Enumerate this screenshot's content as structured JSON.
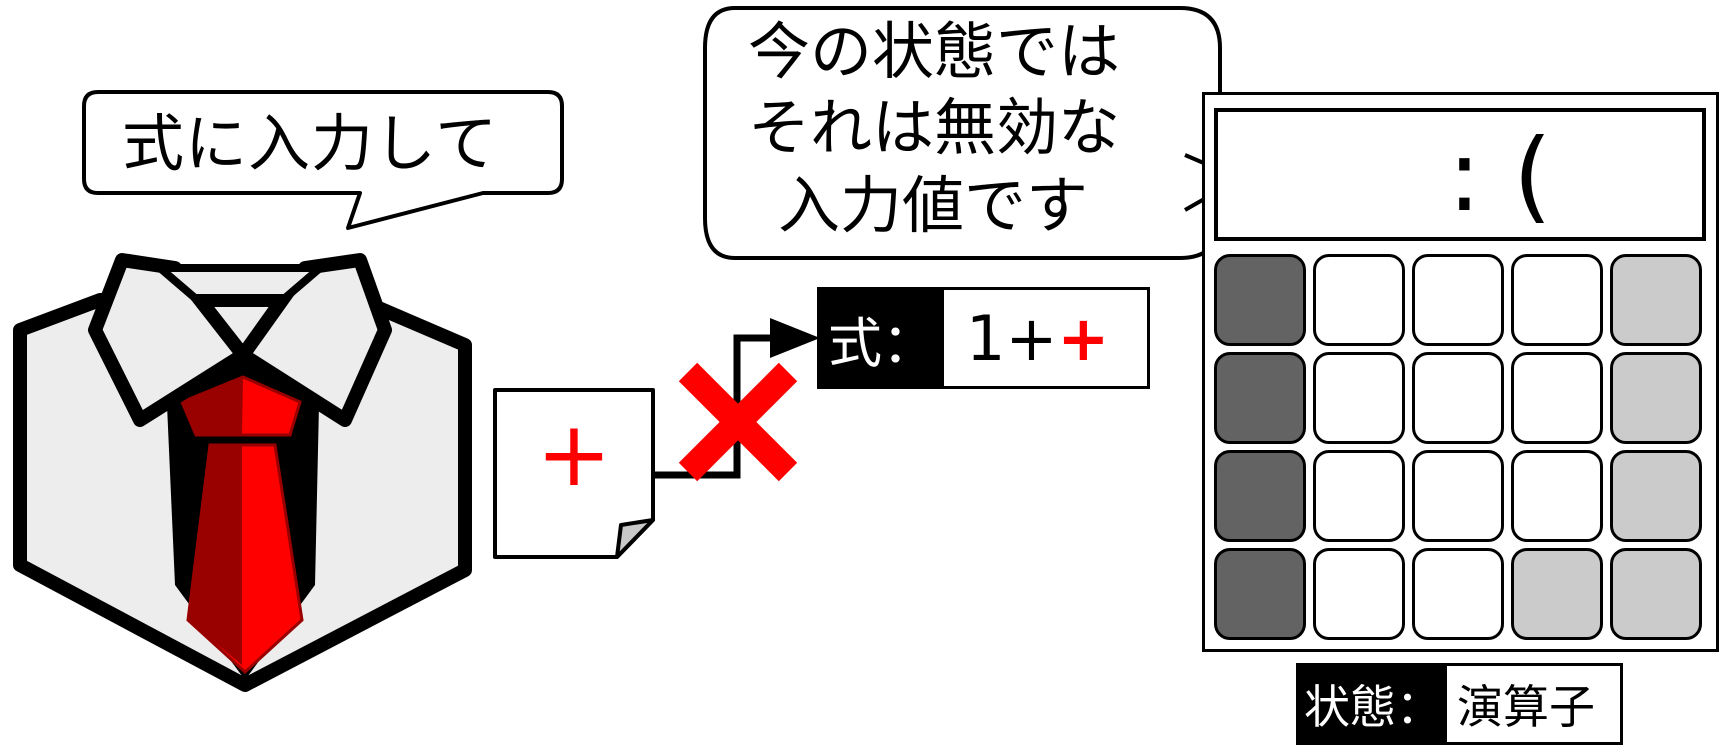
{
  "user_bubble": {
    "text": "式に入力して"
  },
  "calc_bubble": {
    "lines": [
      "今の状態では",
      "それは無効な",
      "入力値です"
    ]
  },
  "input_token": {
    "text": "+"
  },
  "expression": {
    "key": "式：",
    "value_prefix": "1+",
    "value_rejected": "+"
  },
  "calculator": {
    "display": ": (",
    "keypad_rows": [
      [
        "dark",
        "white",
        "white",
        "white",
        "light"
      ],
      [
        "dark",
        "white",
        "white",
        "white",
        "light"
      ],
      [
        "dark",
        "white",
        "white",
        "white",
        "light"
      ],
      [
        "dark",
        "white",
        "white",
        "light",
        "light"
      ]
    ]
  },
  "state": {
    "key": "状態：",
    "value": "演算子"
  },
  "colors": {
    "accent": "#ff0000",
    "dark_key": "#636363",
    "light_key": "#cbcbcb",
    "shirt": "#ededed",
    "tie_dark": "#990000"
  }
}
